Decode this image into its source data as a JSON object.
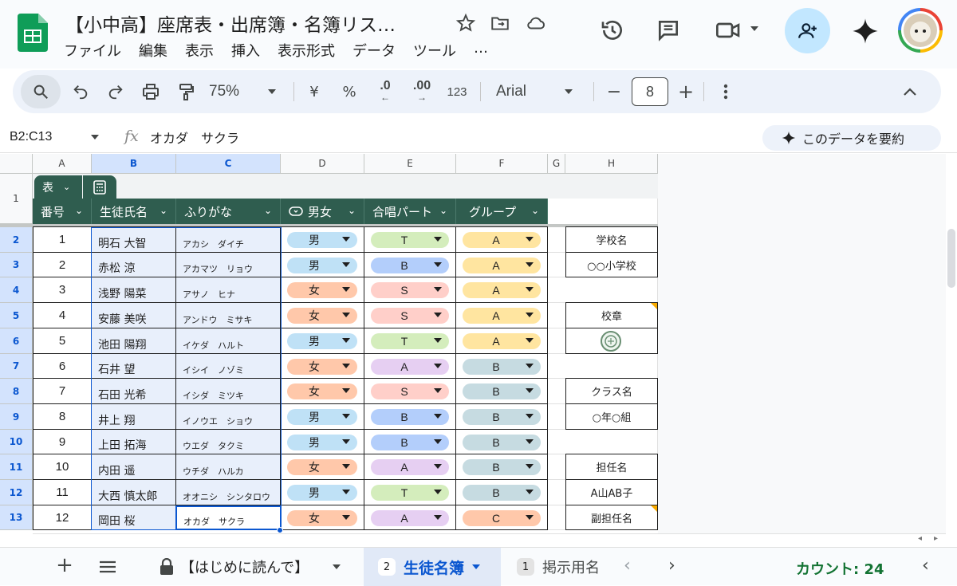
{
  "doc": {
    "title": "【小中高】座席表・出席簿・名簿リス…",
    "menus": [
      "ファイル",
      "編集",
      "表示",
      "挿入",
      "表示形式",
      "データ",
      "ツール",
      "…"
    ]
  },
  "toolbar": {
    "zoom": "75%",
    "currency": "¥",
    "percent": "%",
    "dec_decrease": ".0",
    "dec_increase": ".00",
    "format_123": "123",
    "font": "Arial",
    "font_size": "8",
    "minus": "−",
    "plus": "+"
  },
  "formula_bar": {
    "name_box": "B2:C13",
    "fx": "fx",
    "value": "オカダ　サクラ",
    "summarize_label": "このデータを要約"
  },
  "columns": [
    "A",
    "B",
    "C",
    "D",
    "E",
    "F",
    "G",
    "H"
  ],
  "table": {
    "tab_label": "表",
    "headers": [
      "番号",
      "生徒氏名",
      "ふりがな",
      "男女",
      "合唱パート",
      "グループ"
    ]
  },
  "rows": [
    {
      "row": "2",
      "num": "1",
      "name": "明石 大智",
      "kana": "アカシ　ダイチ",
      "gender": "男",
      "part": "T",
      "group": "A",
      "h": "学校名"
    },
    {
      "row": "3",
      "num": "2",
      "name": "赤松 涼",
      "kana": "アカマツ　リョウ",
      "gender": "男",
      "part": "B",
      "group": "A",
      "h": "○○小学校"
    },
    {
      "row": "4",
      "num": "3",
      "name": "浅野 陽菜",
      "kana": "アサノ　ヒナ",
      "gender": "女",
      "part": "S",
      "group": "A",
      "h": ""
    },
    {
      "row": "5",
      "num": "4",
      "name": "安藤 美咲",
      "kana": "アンドウ　ミサキ",
      "gender": "女",
      "part": "S",
      "group": "A",
      "h": "校章"
    },
    {
      "row": "6",
      "num": "5",
      "name": "池田 陽翔",
      "kana": "イケダ　ハルト",
      "gender": "男",
      "part": "T",
      "group": "A",
      "h": ""
    },
    {
      "row": "7",
      "num": "6",
      "name": "石井 望",
      "kana": "イシイ　ノゾミ",
      "gender": "女",
      "part": "A",
      "group": "B",
      "h": ""
    },
    {
      "row": "8",
      "num": "7",
      "name": "石田 光希",
      "kana": "イシダ　ミツキ",
      "gender": "女",
      "part": "S",
      "group": "B",
      "h": "クラス名"
    },
    {
      "row": "9",
      "num": "8",
      "name": "井上 翔",
      "kana": "イノウエ　ショウ",
      "gender": "男",
      "part": "B",
      "group": "B",
      "h": "○年○組"
    },
    {
      "row": "10",
      "num": "9",
      "name": "上田 拓海",
      "kana": "ウエダ　タクミ",
      "gender": "男",
      "part": "B",
      "group": "B",
      "h": ""
    },
    {
      "row": "11",
      "num": "10",
      "name": "内田 遥",
      "kana": "ウチダ　ハルカ",
      "gender": "女",
      "part": "A",
      "group": "B",
      "h": "担任名"
    },
    {
      "row": "12",
      "num": "11",
      "name": "大西 慎太郎",
      "kana": "オオニシ　シンタロウ",
      "gender": "男",
      "part": "T",
      "group": "B",
      "h": "A山AB子"
    },
    {
      "row": "13",
      "num": "12",
      "name": "岡田 桜",
      "kana": "オカダ　サクラ",
      "gender": "女",
      "part": "A",
      "group": "C",
      "h": "副担任名"
    }
  ],
  "chip_colors": {
    "男": "#bfe1f6",
    "女": "#ffc8aa",
    "T": "#d4edbc",
    "B": "#b3cefb",
    "S": "#ffcfc9",
    "A": "#e6cff2",
    "grpA": "#ffe5a0",
    "grpB": "#c6dbe1",
    "grpC": "#ffc8aa"
  },
  "sheet_tabs": {
    "intro": "【はじめに読んで】",
    "active_badge": "2",
    "active": "生徒名簿",
    "next_badge": "1",
    "next": "掲示用名"
  },
  "status": {
    "count": "カウント: 24"
  },
  "accent": "#0b57d0",
  "table_header_color": "#2f5d4f"
}
